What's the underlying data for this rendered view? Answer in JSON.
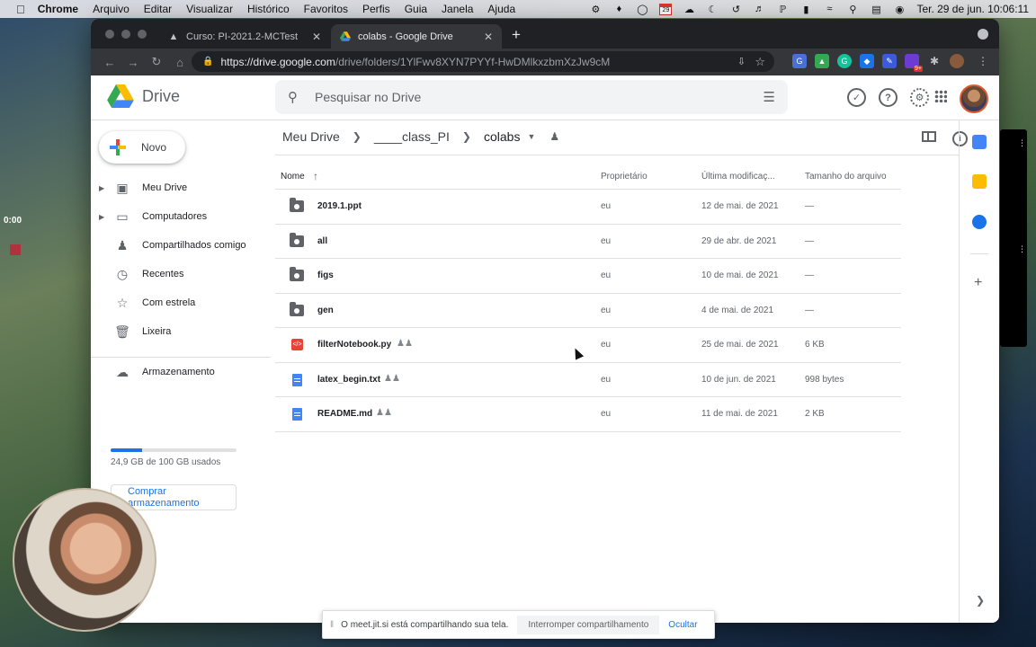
{
  "menubar": {
    "app": "Chrome",
    "items": [
      "Arquivo",
      "Editar",
      "Visualizar",
      "Histórico",
      "Favoritos",
      "Perfis",
      "Guia",
      "Janela",
      "Ajuda"
    ],
    "calendar_day": "29",
    "datetime": "Ter. 29 de jun.  10:06:11"
  },
  "desktop": {
    "timer": "0:00"
  },
  "browser": {
    "tabs": [
      {
        "title": "Curso: PI-2021.2-MCTest",
        "active": false
      },
      {
        "title": "colabs - Google Drive",
        "active": true
      }
    ],
    "url_host": "https://drive.google.com",
    "url_path": "/drive/folders/1YlFwv8XYN7PYYf-HwDMlkxzbmXzJw9cM",
    "ext_badge": "9+"
  },
  "drive": {
    "logo": "Drive",
    "search_placeholder": "Pesquisar no Drive",
    "new_label": "Novo",
    "nav": [
      {
        "label": "Meu Drive",
        "icon": "my-drive-icon",
        "caret": true
      },
      {
        "label": "Computadores",
        "icon": "computer-icon",
        "caret": true
      },
      {
        "label": "Compartilhados comigo",
        "icon": "people-icon",
        "caret": false
      },
      {
        "label": "Recentes",
        "icon": "clock-icon",
        "caret": false
      },
      {
        "label": "Com estrela",
        "icon": "star-icon",
        "caret": false
      },
      {
        "label": "Lixeira",
        "icon": "trash-icon",
        "caret": false
      }
    ],
    "storage": {
      "label": "Armazenamento",
      "used_text": "24,9 GB de 100 GB usados",
      "used_fraction": 0.249,
      "buy_line1": "Comprar",
      "buy_line2": "armazenamento"
    },
    "breadcrumb": [
      "Meu Drive",
      "____class_PI",
      "colabs"
    ],
    "columns": {
      "name": "Nome",
      "owner": "Proprietário",
      "modified": "Última modificaç...",
      "size": "Tamanho do arquivo"
    },
    "files": [
      {
        "name": "2019.1.ppt",
        "type": "folder",
        "shared": false,
        "owner": "eu",
        "modified": "12 de mai. de 2021",
        "size": "—"
      },
      {
        "name": "all",
        "type": "folder",
        "shared": false,
        "owner": "eu",
        "modified": "29 de abr. de 2021",
        "size": "—"
      },
      {
        "name": "figs",
        "type": "folder",
        "shared": false,
        "owner": "eu",
        "modified": "10 de mai. de 2021",
        "size": "—"
      },
      {
        "name": "gen",
        "type": "folder",
        "shared": false,
        "owner": "eu",
        "modified": "4 de mai. de 2021",
        "size": "—"
      },
      {
        "name": "filterNotebook.py",
        "type": "code",
        "shared": true,
        "owner": "eu",
        "modified": "25 de mai. de 2021",
        "size": "6 KB"
      },
      {
        "name": "latex_begin.txt",
        "type": "doc",
        "shared": true,
        "owner": "eu",
        "modified": "10 de jun. de 2021",
        "size": "998 bytes"
      },
      {
        "name": "README.md",
        "type": "doc",
        "shared": true,
        "owner": "eu",
        "modified": "11 de mai. de 2021",
        "size": "2 KB"
      }
    ]
  },
  "share_banner": {
    "message": "O meet.jit.si está compartilhando sua tela.",
    "stop_label": "Interromper compartilhamento",
    "hide_label": "Ocultar"
  },
  "colors": {
    "accent": "#1a73e8",
    "chrome_dark": "#202124",
    "chrome_toolbar": "#35363a"
  }
}
